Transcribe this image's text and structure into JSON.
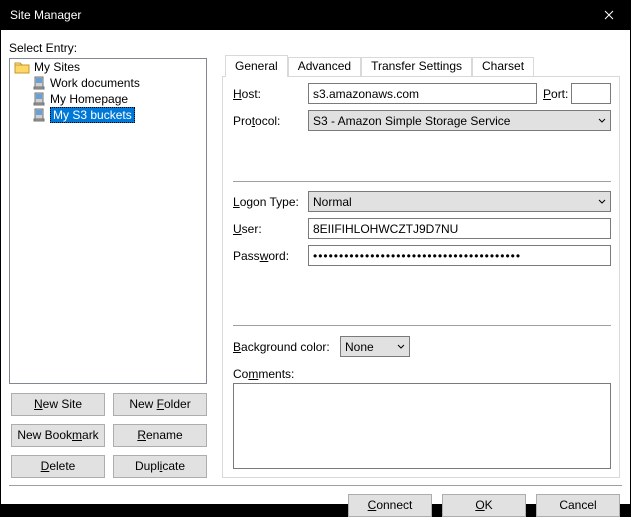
{
  "window": {
    "title": "Site Manager"
  },
  "left": {
    "select_entry": "Select Entry:",
    "tree": {
      "root": "My Sites",
      "items": [
        {
          "label": "Work documents"
        },
        {
          "label": "My Homepage"
        },
        {
          "label": "My S3 buckets",
          "selected": true
        }
      ]
    },
    "buttons": {
      "new_site_pre": "",
      "new_site_u": "N",
      "new_site_post": "ew Site",
      "new_folder_pre": "New ",
      "new_folder_u": "F",
      "new_folder_post": "older",
      "new_bkm_pre": "New Book",
      "new_bkm_u": "m",
      "new_bkm_post": "ark",
      "rename_pre": "",
      "rename_u": "R",
      "rename_post": "ename",
      "delete_pre": "",
      "delete_u": "D",
      "delete_post": "elete",
      "dup_pre": "Dupl",
      "dup_u": "i",
      "dup_post": "cate"
    }
  },
  "tabs": [
    "General",
    "Advanced",
    "Transfer Settings",
    "Charset"
  ],
  "general": {
    "host_l_pre": "",
    "host_l_u": "H",
    "host_l_post": "ost:",
    "host": "s3.amazonaws.com",
    "port_l_pre": "",
    "port_l_u": "P",
    "port_l_post": "ort:",
    "port": "",
    "proto_l_pre": "Pro",
    "proto_l_u": "t",
    "proto_l_post": "ocol:",
    "protocol": "S3 - Amazon Simple Storage Service",
    "logon_l_pre": "",
    "logon_l_u": "L",
    "logon_l_post": "ogon Type:",
    "logon_type": "Normal",
    "user_l_pre": "",
    "user_l_u": "U",
    "user_l_post": "ser:",
    "user": "8EIIFIHLOHWCZTJ9D7NU",
    "pass_l_pre": "Pass",
    "pass_l_u": "w",
    "pass_l_post": "ord:",
    "password": "••••••••••••••••••••••••••••••••••••••••",
    "bg_l_pre": "",
    "bg_l_u": "B",
    "bg_l_post": "ackground color:",
    "background_color": "None",
    "comments_l_pre": "Co",
    "comments_l_u": "m",
    "comments_l_post": "ments:",
    "comments": ""
  },
  "bottom": {
    "connect_pre": "",
    "connect_u": "C",
    "connect_post": "onnect",
    "ok_pre": "",
    "ok_u": "O",
    "ok_post": "K",
    "cancel": "Cancel"
  }
}
